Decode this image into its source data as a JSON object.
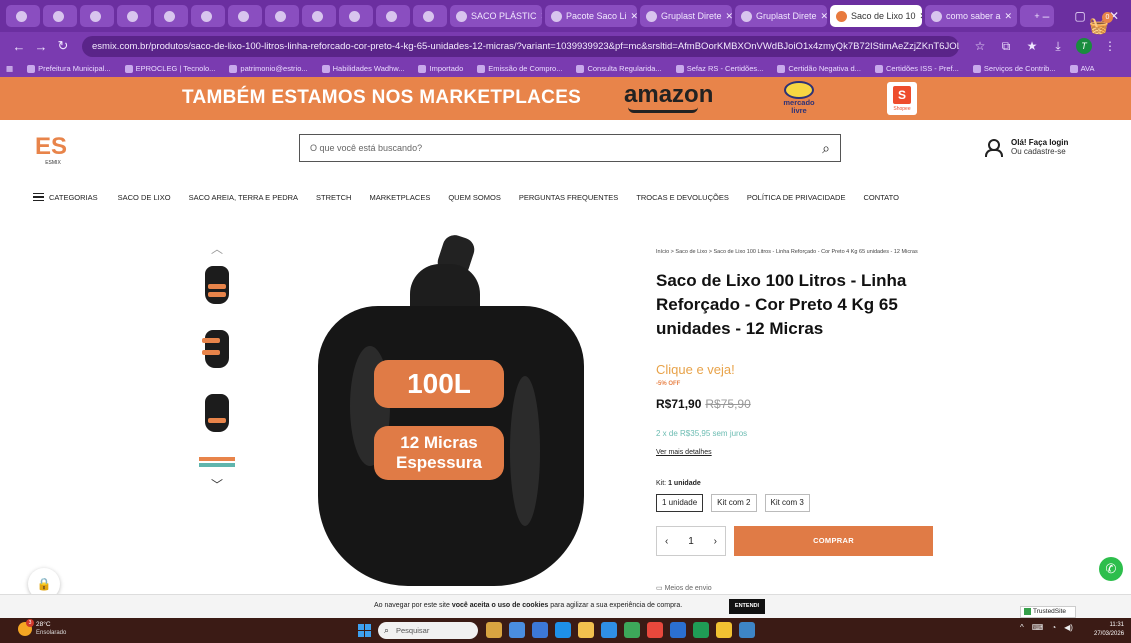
{
  "browser": {
    "tabs": [
      {
        "label": "SACO PLÁSTIC",
        "active": false
      },
      {
        "label": "Pacote Saco Li",
        "active": false
      },
      {
        "label": "Gruplast Direte",
        "active": false
      },
      {
        "label": "Gruplast Direte",
        "active": false
      },
      {
        "label": "Saco de Lixo 10",
        "active": true
      },
      {
        "label": "como saber a",
        "active": false
      }
    ],
    "url": "esmix.com.br/produtos/saco-de-lixo-100-litros-linha-reforcado-cor-preto-4-kg-65-unidades-12-micras/?variant=1039939923&pf=mc&srsltid=AfmBOorKMBXOnVWdBJoiO1x4zmyQk7B72IStimAeZzjZKnT6JOLk_mJ3ft8",
    "bookmarks": [
      "Prefeitura Municipal...",
      "EPROCLEG | Tecnolo...",
      "patrimonio@estrio...",
      "Habilidades Wadhw...",
      "Importado",
      "Emissão de Compro...",
      "Consulta Regularida...",
      "Sefaz RS - Certidões...",
      "Certidão Negativa d...",
      "Certidões ISS - Pref...",
      "Serviços de Contrib...",
      "AVA"
    ]
  },
  "promo": {
    "headline": "TAMBÉM ESTAMOS NOS MARKETPLACES",
    "amazon": "amazon",
    "mercado_livre": "mercado livre",
    "shopee": "Shopee"
  },
  "header": {
    "logo_text": "ES",
    "logo_sub": "ESMIX",
    "search_placeholder": "O que você está buscando?",
    "account_line1": "Olá! Faça login",
    "account_line2": "Ou cadastre-se",
    "cart_count": "0"
  },
  "menu": {
    "categories_label": "CATEGORIAS",
    "items": [
      "SACO DE LIXO",
      "SACO AREIA, TERRA E PEDRA",
      "STRETCH",
      "MARKETPLACES",
      "QUEM SOMOS",
      "PERGUNTAS FREQUENTES",
      "TROCAS E DEVOLUÇÕES",
      "POLÍTICA DE PRIVACIDADE",
      "CONTATO"
    ]
  },
  "product": {
    "breadcrumb": "Início  >  Saco de Lixo  >  Saco de Lixo 100 Litros - Linha Reforçado - Cor Preto 4 Kg 65 unidades - 12 Micras",
    "title": "Saco de Lixo 100 Litros - Linha Reforçado - Cor Preto 4 Kg 65 unidades - 12 Micras",
    "image_badge_volume": "100L",
    "image_badge_thickness_1": "12 Micras",
    "image_badge_thickness_2": "Espessura",
    "cta_text": "Clique e veja!",
    "discount": "-5% OFF",
    "price": "R$71,90",
    "price_old": "R$75,90",
    "installments": "2 x de R$35,95 sem juros",
    "more_details": "Ver mais detalhes",
    "kit_label": "Kit:",
    "kit_selected": "1 unidade",
    "kit_options": [
      "1 unidade",
      "Kit com 2",
      "Kit com 3"
    ],
    "quantity": "1",
    "buy_label": "COMPRAR",
    "shipping_peek": "Meios de envio"
  },
  "cookie": {
    "text_before": "Ao navegar por este site ",
    "text_bold": "você aceita o uso de cookies",
    "text_after": " para agilizar a sua experiência de compra.",
    "button": "ENTENDI"
  },
  "trusted_site": "TrustedSite",
  "taskbar": {
    "temperature": "28°C",
    "weather": "Ensolarado",
    "weather_badge": "3",
    "search_placeholder": "Pesquisar",
    "time": "11:31",
    "date": "27/03/2026"
  },
  "colors": {
    "brand_orange": "#e07b46",
    "promo_bg": "#e8844a",
    "browser_purple": "#6b2fa0",
    "installment_teal": "#6cbcb2",
    "cta_yellow": "#e8a34a"
  }
}
